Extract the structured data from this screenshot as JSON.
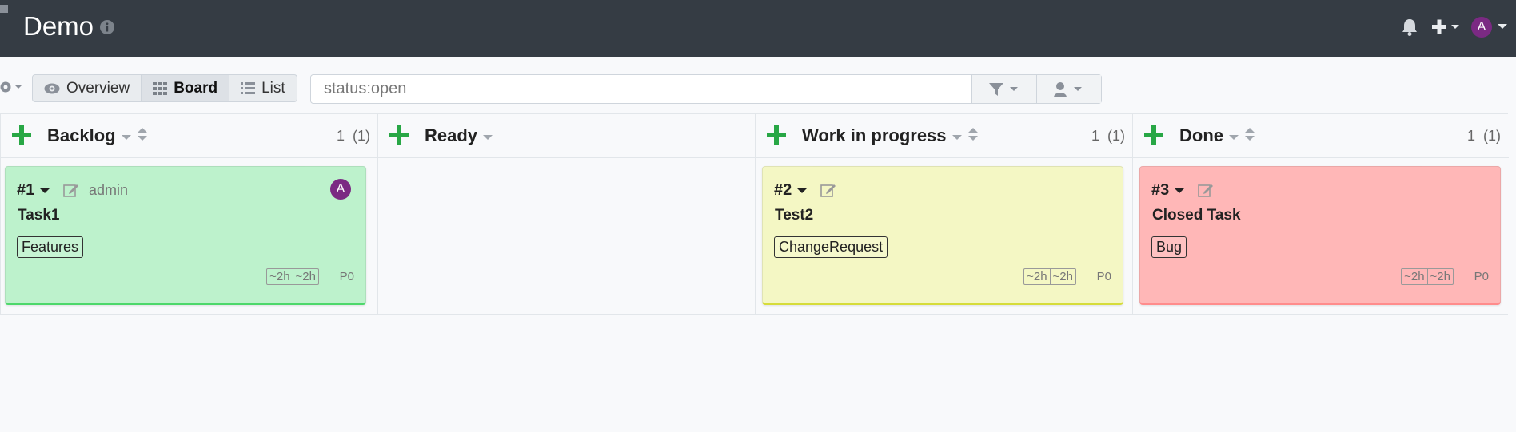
{
  "header": {
    "brand": "Demo",
    "user_initial": "A"
  },
  "toolbar": {
    "views": [
      {
        "label": "Overview",
        "icon": "eye-icon"
      },
      {
        "label": "Board",
        "icon": "board-icon"
      },
      {
        "label": "List",
        "icon": "list-icon"
      }
    ],
    "active_view": "Board",
    "search": {
      "value": "status:open"
    }
  },
  "columns": [
    {
      "title": "Backlog",
      "count": "1",
      "total": "(1)"
    },
    {
      "title": "Ready",
      "count": "",
      "total": ""
    },
    {
      "title": "Work in progress",
      "count": "1",
      "total": "(1)"
    },
    {
      "title": "Done",
      "count": "1",
      "total": "(1)"
    }
  ],
  "cards": [
    {
      "id": "#1",
      "assignee": "admin",
      "avatar": "A",
      "title": "Task1",
      "tag": "Features",
      "estimate": "~2h",
      "spent": "~2h",
      "priority": "P0",
      "color": "#bdf2cc"
    },
    {
      "id": "#2",
      "title": "Test2",
      "tag": "ChangeRequest",
      "estimate": "~2h",
      "spent": "~2h",
      "priority": "P0",
      "color": "#f4f7c4"
    },
    {
      "id": "#3",
      "title": "Closed Task",
      "tag": "Bug",
      "estimate": "~2h",
      "spent": "~2h",
      "priority": "P0",
      "color": "#ffb7b7"
    }
  ],
  "colors": {
    "header_bg": "#353c44",
    "accent_green": "#28a745",
    "avatar_purple": "#7b2a83"
  }
}
